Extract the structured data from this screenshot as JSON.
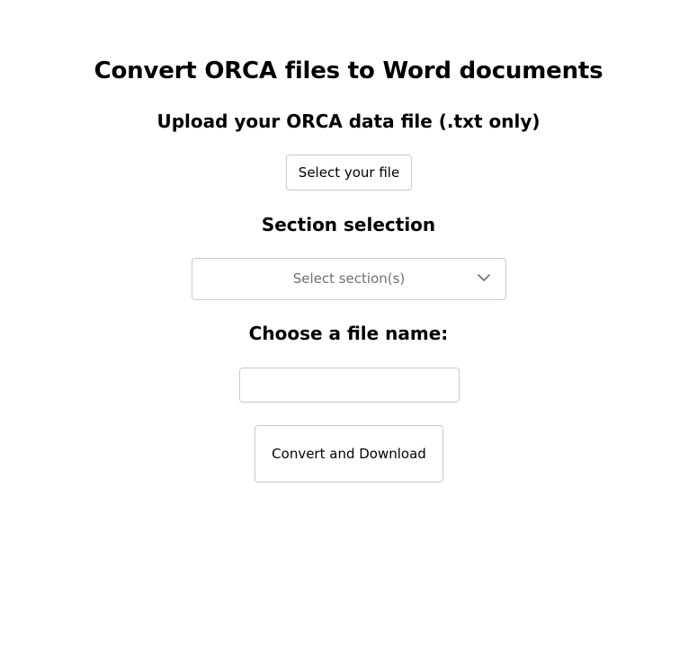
{
  "page": {
    "title": "Convert ORCA files to Word documents"
  },
  "upload": {
    "heading": "Upload your ORCA data file (.txt only)",
    "button_label": "Select your file"
  },
  "section": {
    "heading": "Section selection",
    "placeholder": "Select section(s)",
    "icon": "chevron-down-icon"
  },
  "filename": {
    "heading": "Choose a file name:",
    "value": "",
    "placeholder": ""
  },
  "convert": {
    "button_label": "Convert and Download"
  },
  "colors": {
    "border": "#c9c9c9",
    "placeholder_text": "#6f6f6f",
    "text": "#000000",
    "background": "#ffffff"
  }
}
